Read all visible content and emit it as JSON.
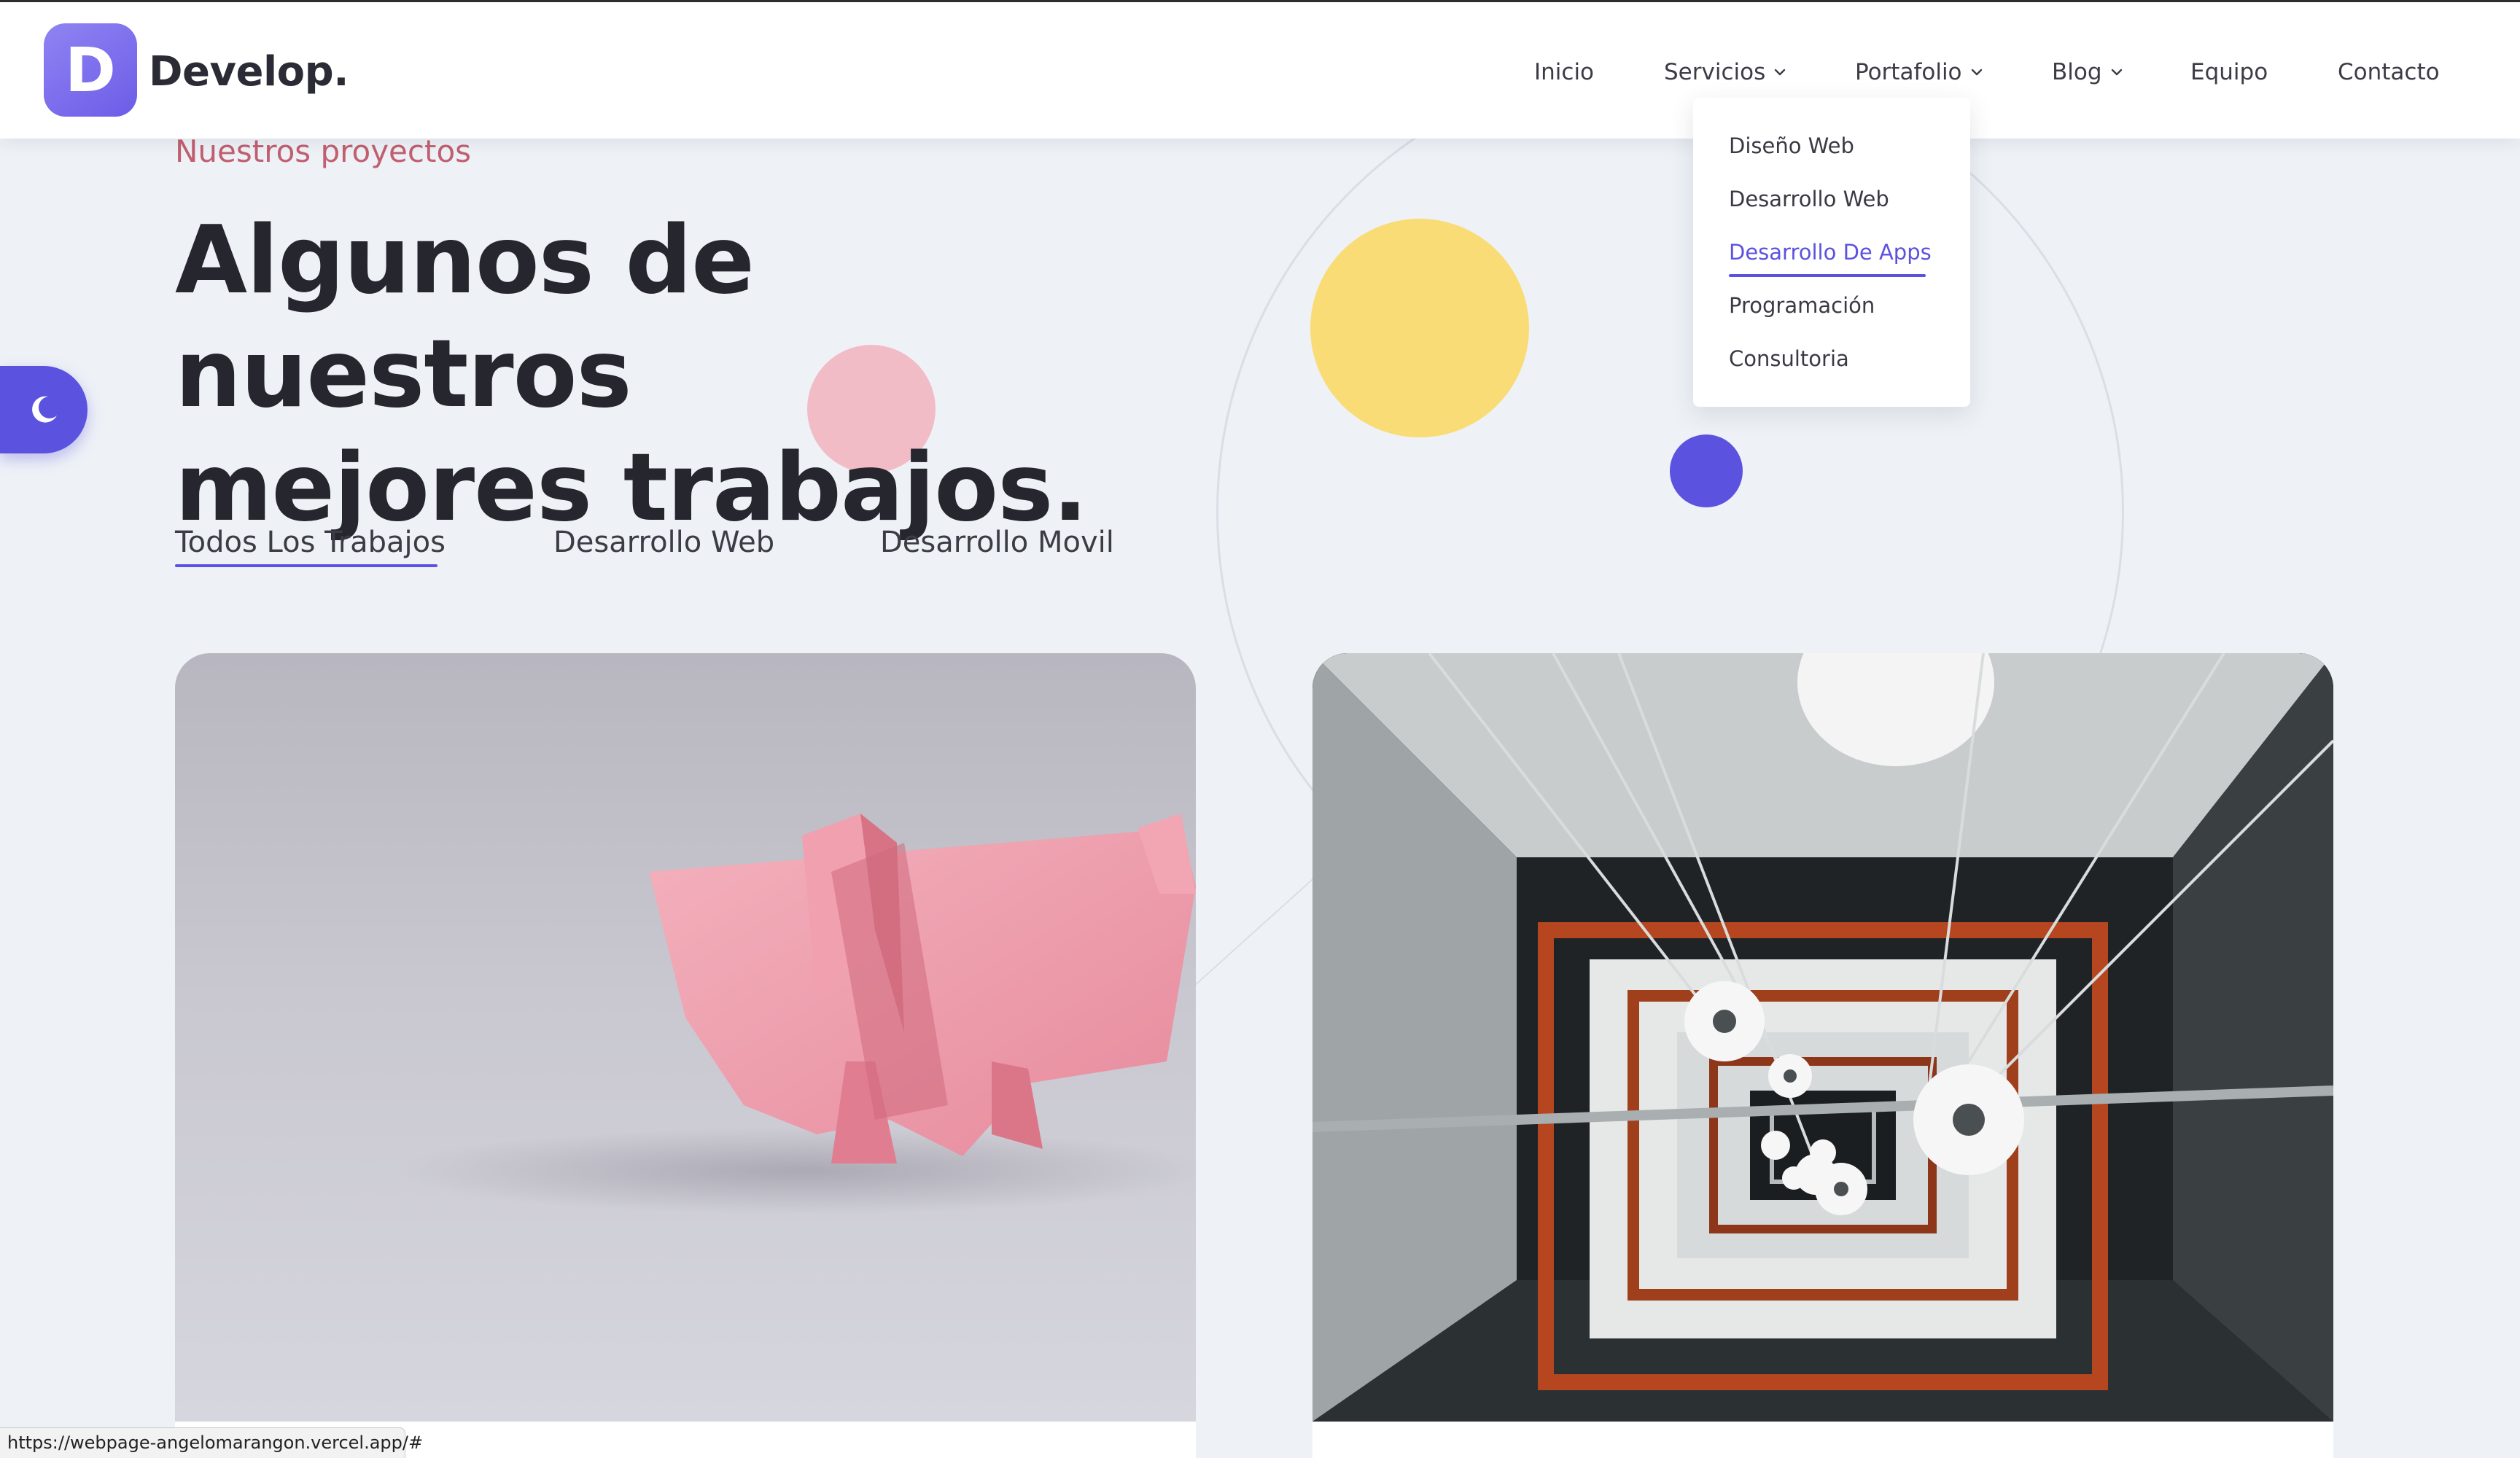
{
  "brand": {
    "logo_letter": "D",
    "name": "Develop.",
    "accent_color": "#5b52e0",
    "logo_gradient": [
      "#8f84f2",
      "#6d5ce8"
    ]
  },
  "nav": {
    "items": [
      {
        "label": "Inicio",
        "has_dropdown": false
      },
      {
        "label": "Servicios",
        "has_dropdown": true
      },
      {
        "label": "Portafolio",
        "has_dropdown": true
      },
      {
        "label": "Blog",
        "has_dropdown": true
      },
      {
        "label": "Equipo",
        "has_dropdown": false
      },
      {
        "label": "Contacto",
        "has_dropdown": false
      }
    ]
  },
  "dropdown": {
    "items": [
      {
        "label": "Diseño Web"
      },
      {
        "label": "Desarrollo Web"
      },
      {
        "label": "Desarrollo De Apps",
        "active": true
      },
      {
        "label": "Programación"
      },
      {
        "label": "Consultoria"
      }
    ]
  },
  "hero": {
    "eyebrow": "Nuestros proyectos",
    "title_line1": "Algunos de nuestros",
    "title_line2": "mejores trabajos."
  },
  "filters": {
    "tabs": [
      {
        "label": "Todos Los Trabajos",
        "active": true
      },
      {
        "label": "Desarrollo Web",
        "active": false
      },
      {
        "label": "Desarrollo Movil",
        "active": false
      }
    ]
  },
  "projects": [
    {
      "image_subject": "pink-origami-pig"
    },
    {
      "image_subject": "spiral-stairwell-with-lamps"
    }
  ],
  "theme_toggle": {
    "icon": "moon-icon"
  },
  "status_bar": {
    "url": "https://webpage-angelomarangon.vercel.app/#"
  },
  "colors": {
    "background": "#eef2f6",
    "eyebrow": "#c25f70",
    "yellow_decoration": "#f9dc75",
    "pink_decoration": "#f2bcc6",
    "blue_decoration": "#5b52e0"
  }
}
